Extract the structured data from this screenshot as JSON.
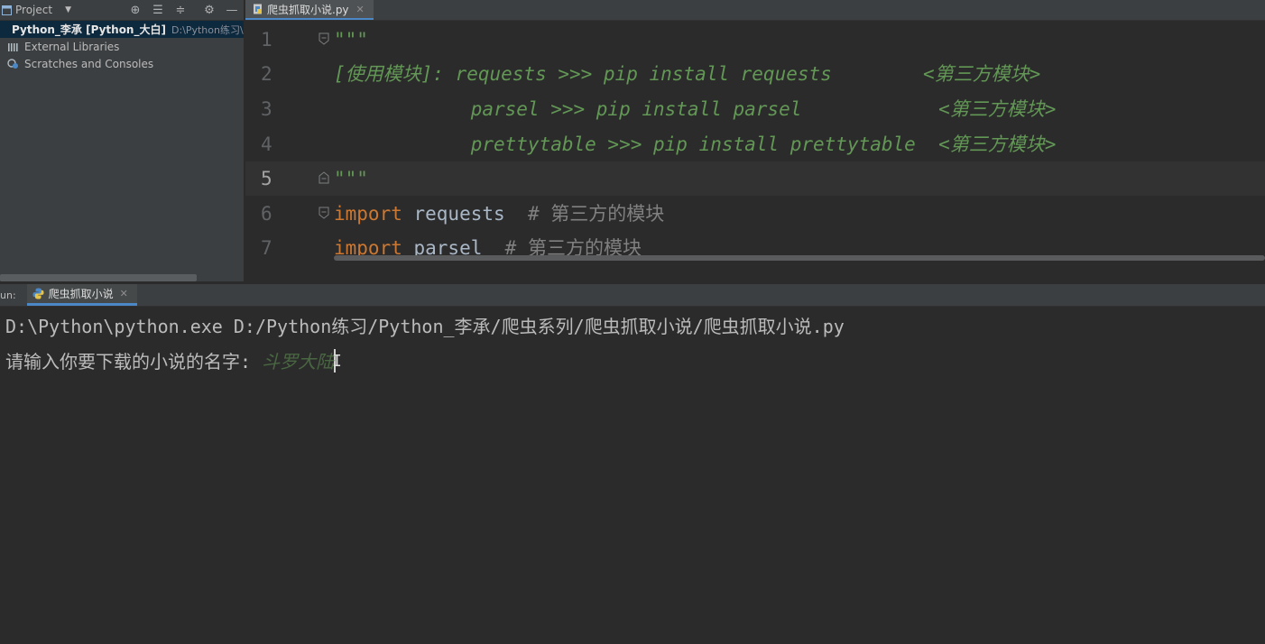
{
  "colors": {
    "background": "#2b2b2b",
    "panel": "#3c3f41",
    "docstring": "#629755",
    "keyword": "#cc7832",
    "comment": "#808080",
    "accent": "#4a88c7"
  },
  "project": {
    "title": "Project",
    "tree": [
      {
        "icon": "folder-icon",
        "label": "Python_李承 [Python_大白]",
        "hint": "D:\\Python练习\\P"
      },
      {
        "icon": "library-icon",
        "label": "External Libraries"
      },
      {
        "icon": "scratches-icon",
        "label": "Scratches and Consoles"
      }
    ]
  },
  "editor": {
    "tab": {
      "label": "爬虫抓取小说.py"
    },
    "lines": [
      {
        "num": "1",
        "doc": "\"\"\""
      },
      {
        "num": "2",
        "doc": "[使用模块]: requests >>> pip install requests        <第三方模块>"
      },
      {
        "num": "3",
        "doc": "            parsel >>> pip install parsel            <第三方模块>"
      },
      {
        "num": "4",
        "doc": "            prettytable >>> pip install prettytable  <第三方模块>"
      },
      {
        "num": "5",
        "doc": "\"\"\""
      },
      {
        "num": "6",
        "kw": "import",
        "id": " requests  ",
        "cmt": "# 第三方的模块"
      },
      {
        "num": "7",
        "kw": "import",
        "id": " parsel  ",
        "cmt": "# 第三方的模块"
      }
    ]
  },
  "run": {
    "label": "un:",
    "tab": {
      "label": "爬虫抓取小说"
    },
    "command": "D:\\Python\\python.exe D:/Python练习/Python_李承/爬虫系列/爬虫抓取小说/爬虫抓取小说.py",
    "prompt": "请输入你要下载的小说的名字: ",
    "input": "斗罗大陆"
  }
}
